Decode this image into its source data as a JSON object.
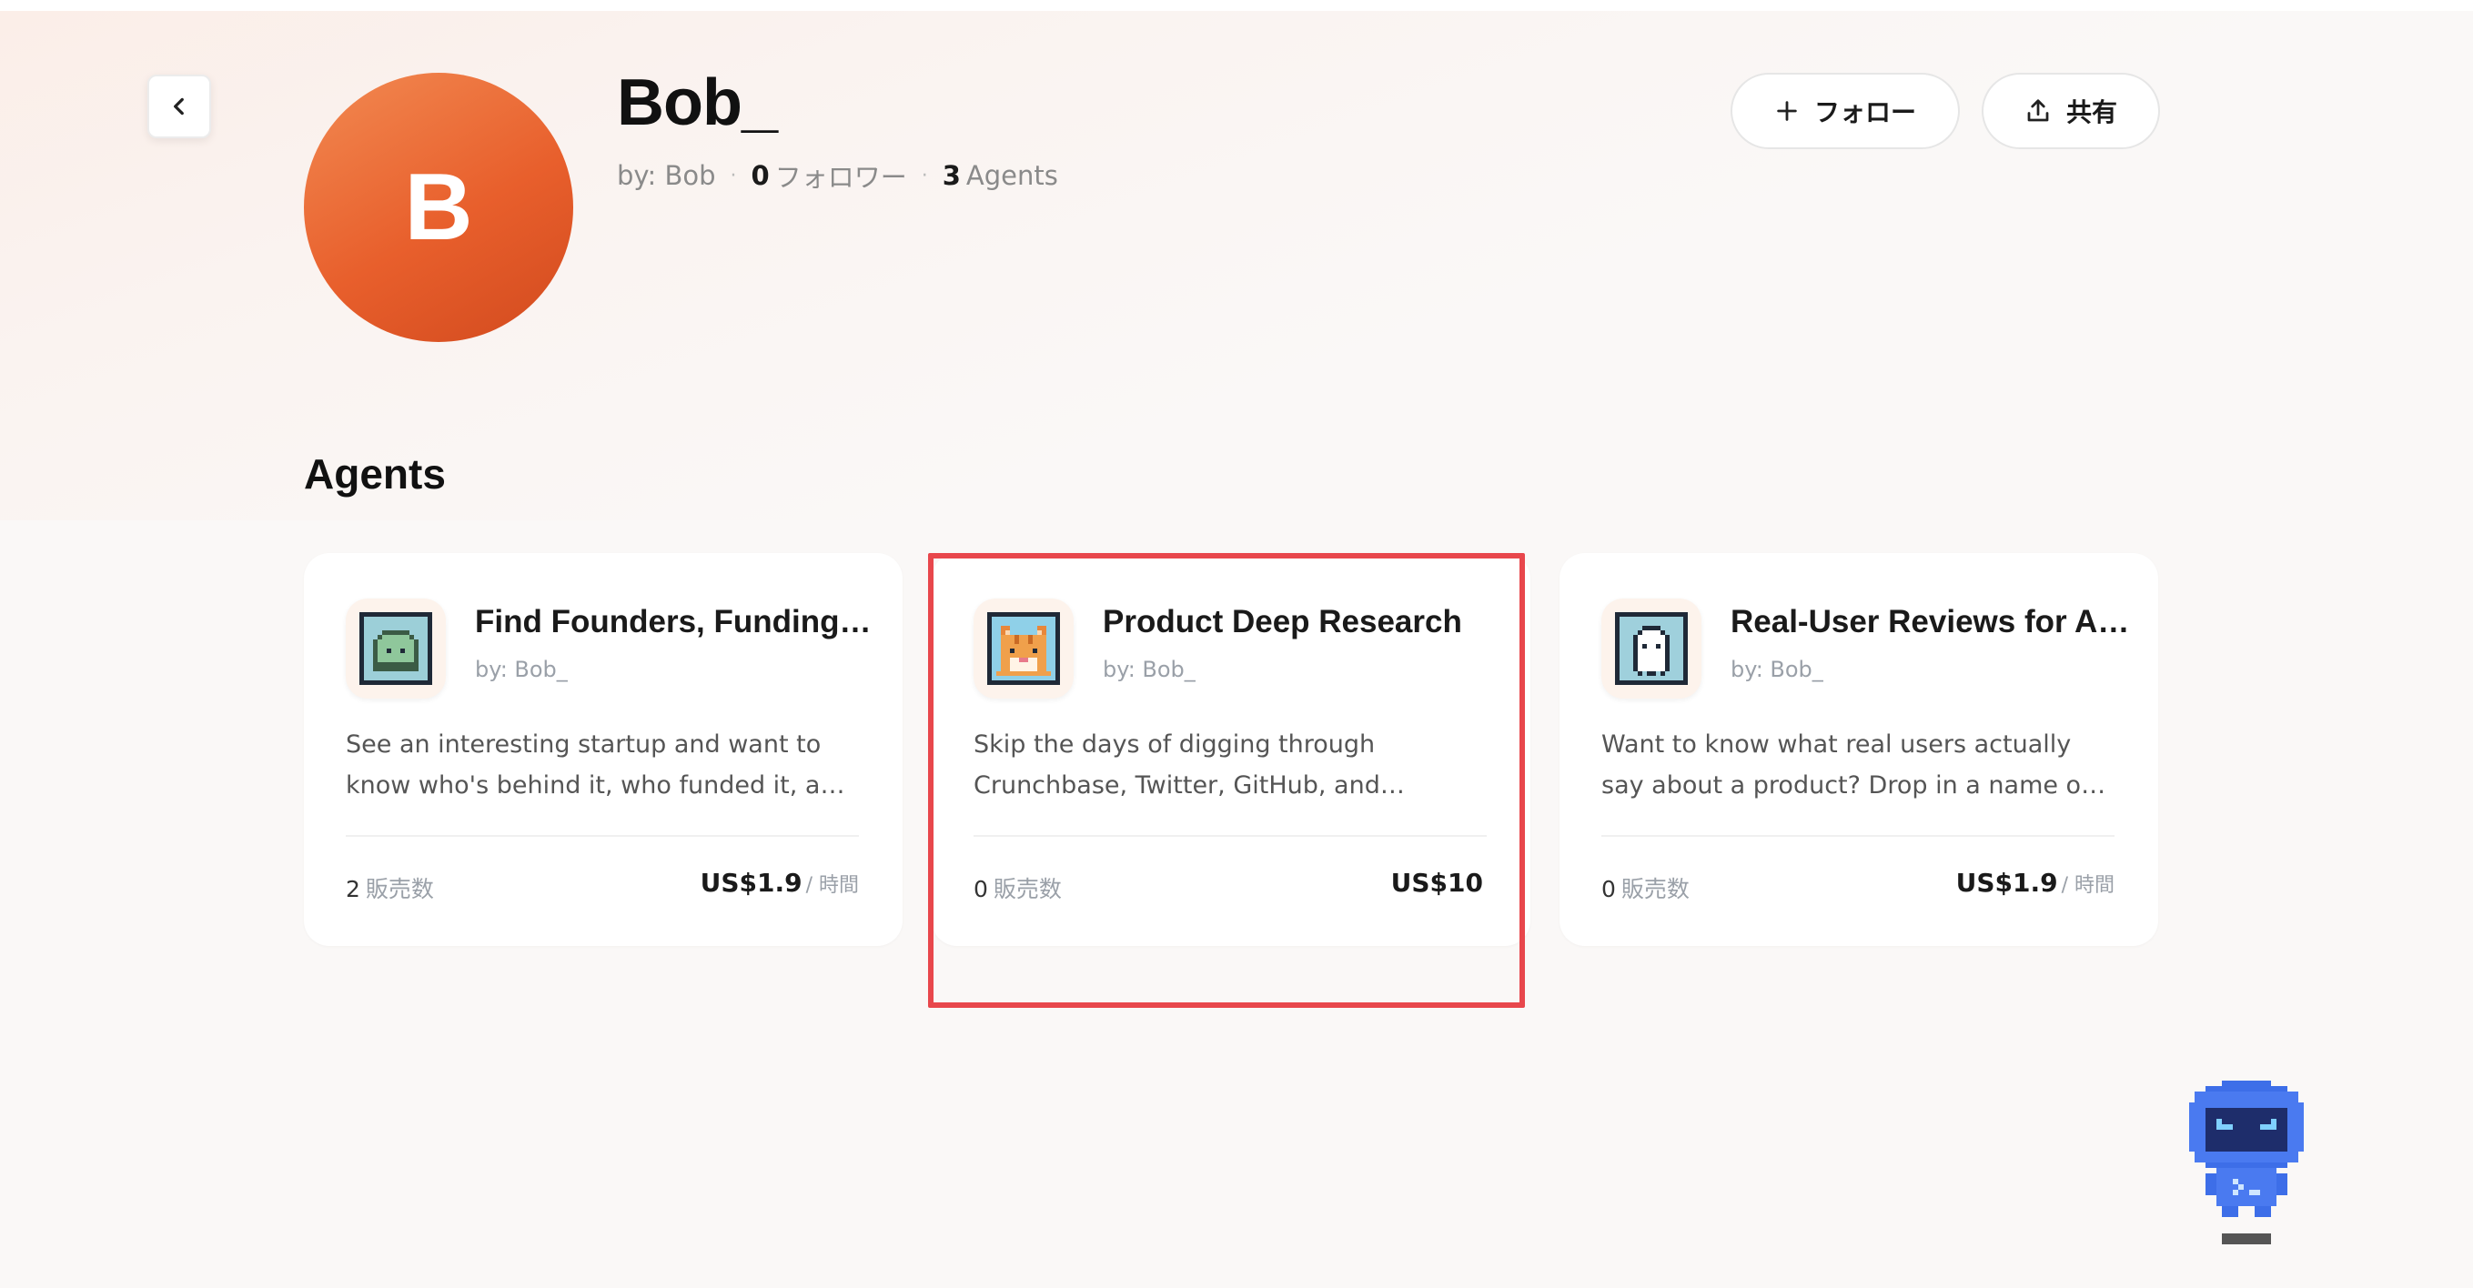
{
  "profile": {
    "avatar_letter": "B",
    "name": "Bob_",
    "by_label": "by: Bob",
    "followers_count": "0",
    "followers_label": "フォロワー",
    "agents_count": "3",
    "agents_label": "Agents"
  },
  "actions": {
    "follow_label": "フォロー",
    "share_label": "共有"
  },
  "section": {
    "title": "Agents"
  },
  "agents": [
    {
      "icon": "pixel-slime-icon",
      "title": "Find Founders, Funding & Traction Signals",
      "author": "by: Bob_",
      "description": "See an interesting startup and want to know who's behind it, who funded it, and how to...",
      "sales_count": "2",
      "sales_label": "販売数",
      "price": "US$1.9",
      "price_unit": "/ 時間"
    },
    {
      "icon": "pixel-cat-icon",
      "title": "Product Deep Research",
      "author": "by: Bob_",
      "description": "Skip the days of digging through Crunchbase, Twitter, GitHub, and Reddit....",
      "sales_count": "0",
      "sales_label": "販売数",
      "price": "US$10",
      "price_unit": ""
    },
    {
      "icon": "pixel-ghost-icon",
      "title": "Real-User Reviews for Any Product",
      "author": "by: Bob_",
      "description": "Want to know what real users actually say about a product? Drop in a name or link —...",
      "sales_count": "0",
      "sales_label": "販売数",
      "price": "US$1.9",
      "price_unit": "/ 時間"
    }
  ],
  "colors": {
    "avatar": "#e8642e",
    "highlight": "#e8474c",
    "mascot": "#3d6ee8"
  }
}
